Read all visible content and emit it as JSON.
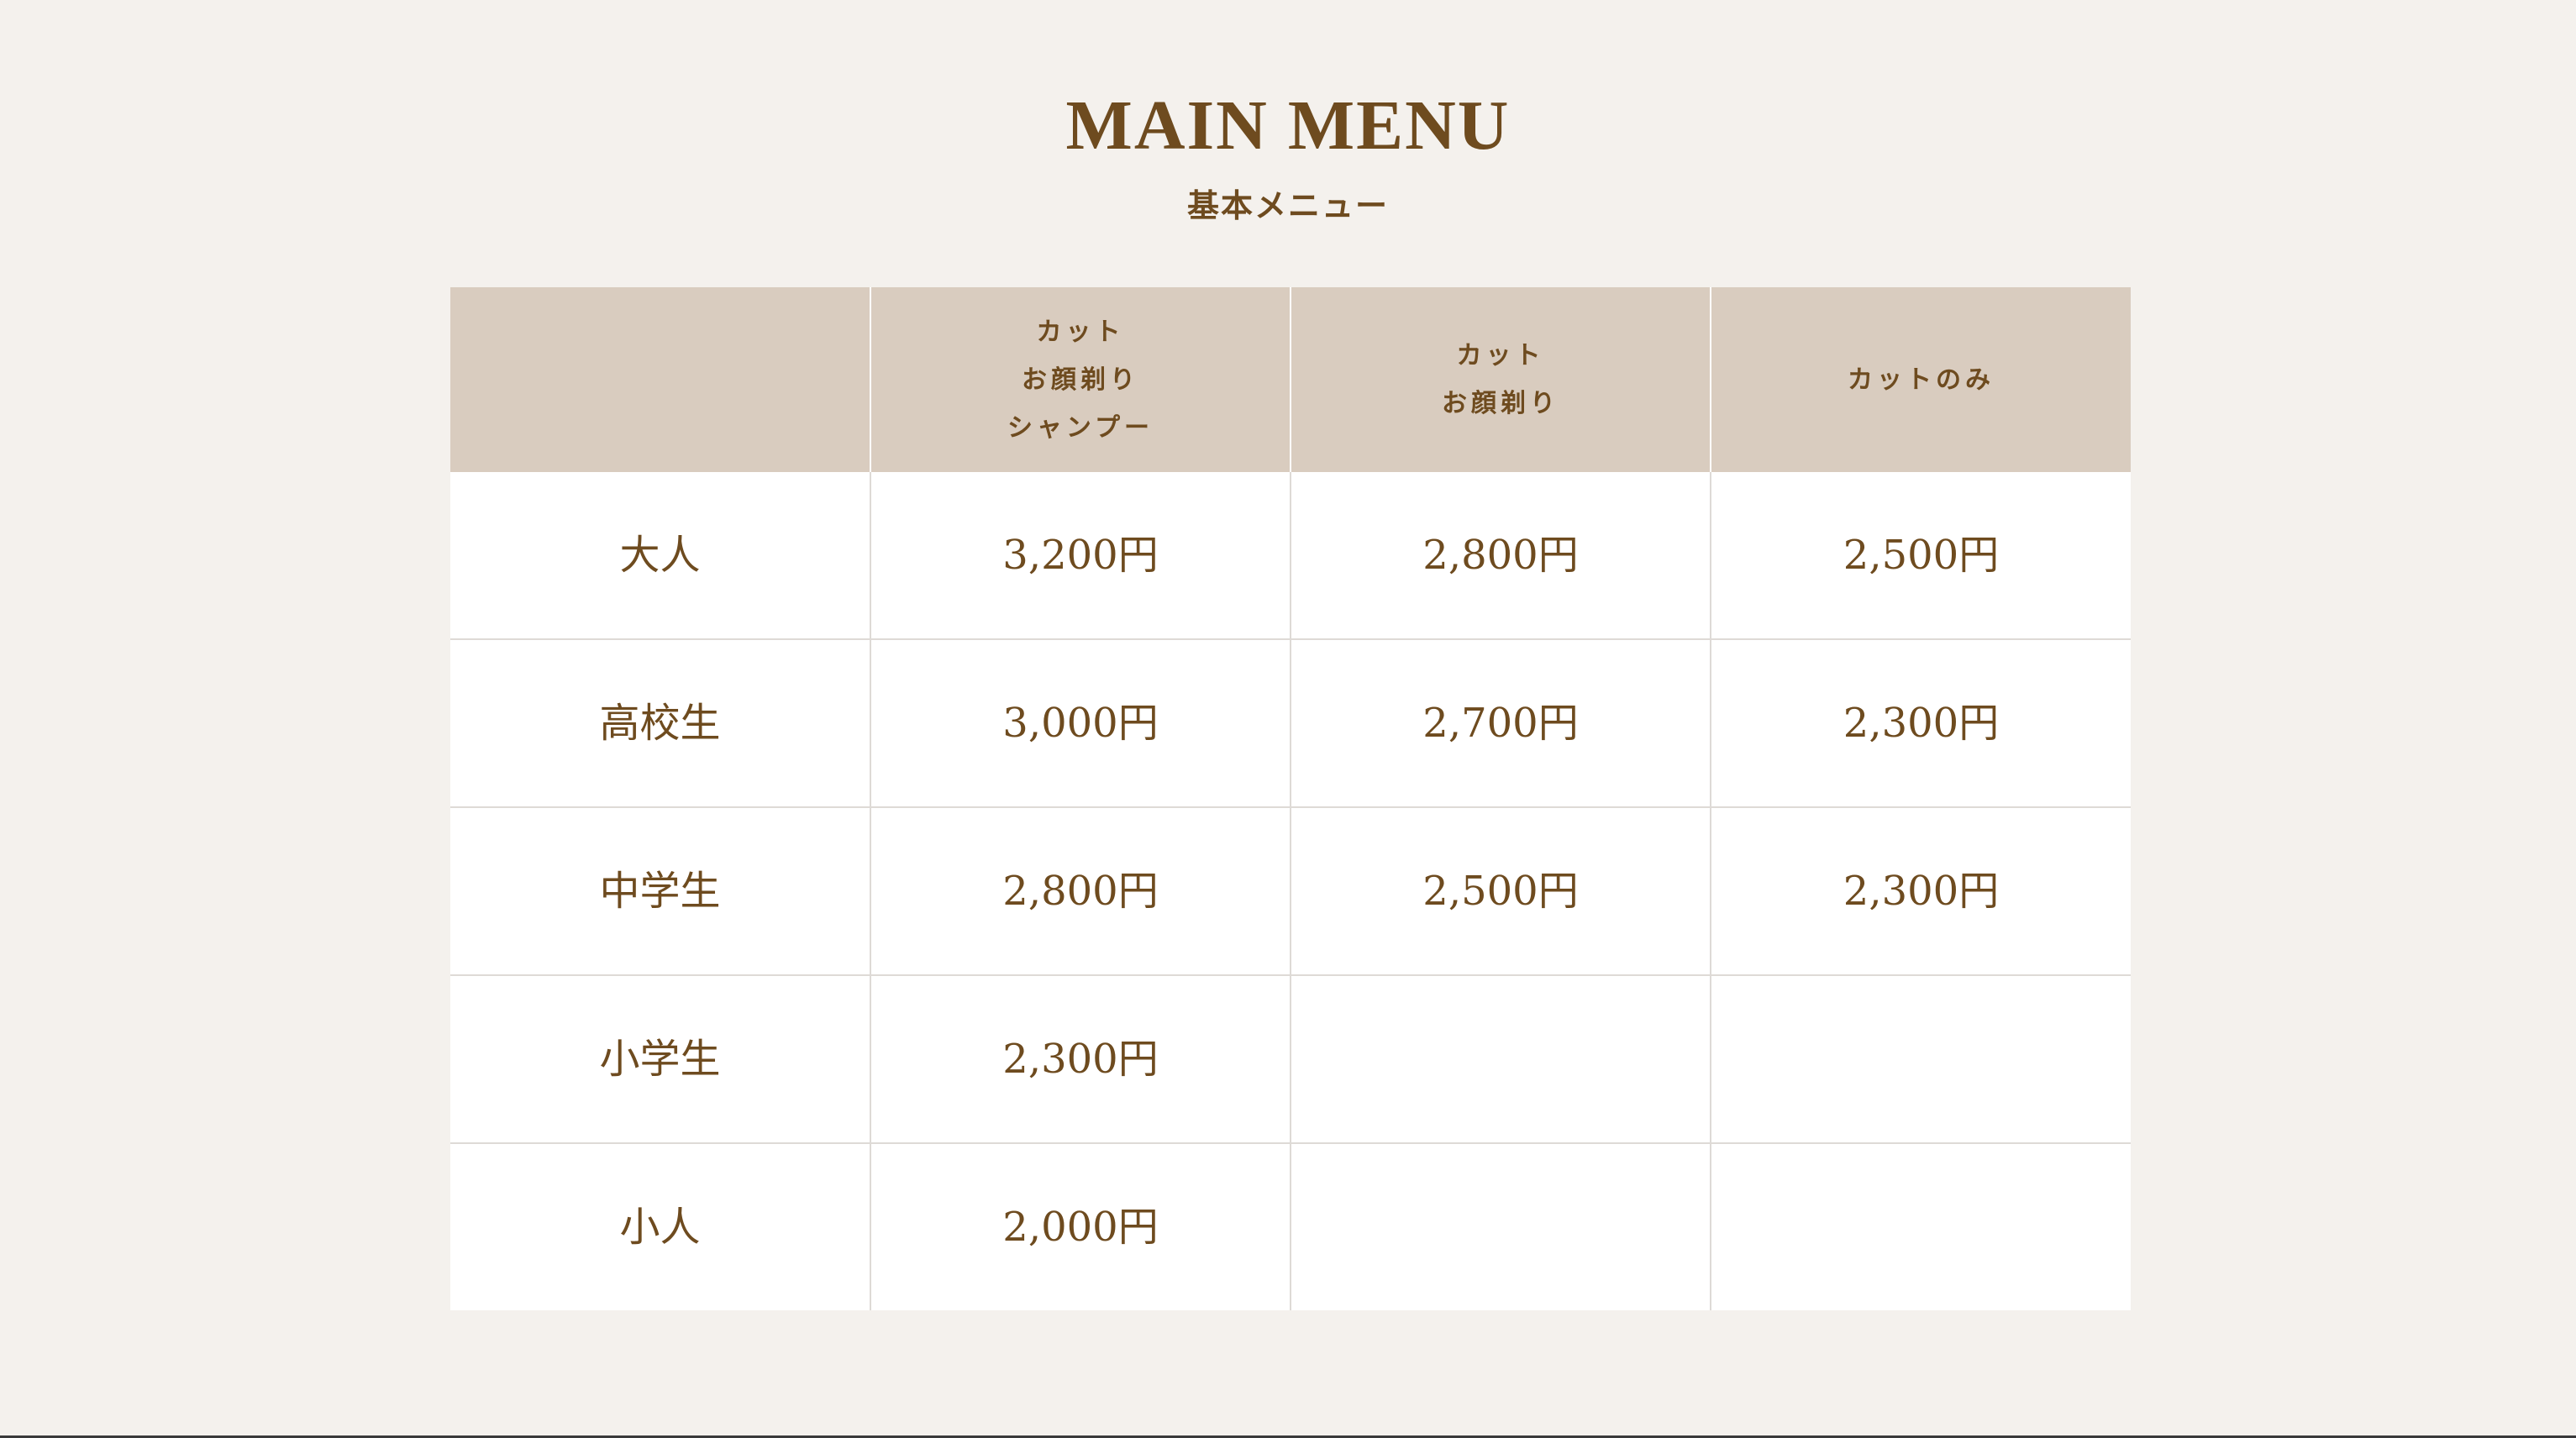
{
  "header": {
    "title": "MAIN MENU",
    "subtitle": "基本メニュー"
  },
  "table": {
    "columns": [
      {
        "lines": []
      },
      {
        "lines": [
          "カット",
          "お顔剃り",
          "シャンプー"
        ]
      },
      {
        "lines": [
          "カット",
          "お顔剃り"
        ]
      },
      {
        "lines": [
          "カットのみ"
        ]
      }
    ],
    "rows": [
      {
        "label": "大人",
        "prices": [
          "3,200円",
          "2,800円",
          "2,500円"
        ]
      },
      {
        "label": "高校生",
        "prices": [
          "3,000円",
          "2,700円",
          "2,300円"
        ]
      },
      {
        "label": "中学生",
        "prices": [
          "2,800円",
          "2,500円",
          "2,300円"
        ]
      },
      {
        "label": "小学生",
        "prices": [
          "2,300円",
          "",
          ""
        ]
      },
      {
        "label": "小人",
        "prices": [
          "2,000円",
          "",
          ""
        ]
      }
    ]
  },
  "colors": {
    "background": "#f4f1ed",
    "header_row": "#d9ccbf",
    "text": "#6e4b1f",
    "cell": "#ffffff",
    "border": "#dedad6"
  }
}
